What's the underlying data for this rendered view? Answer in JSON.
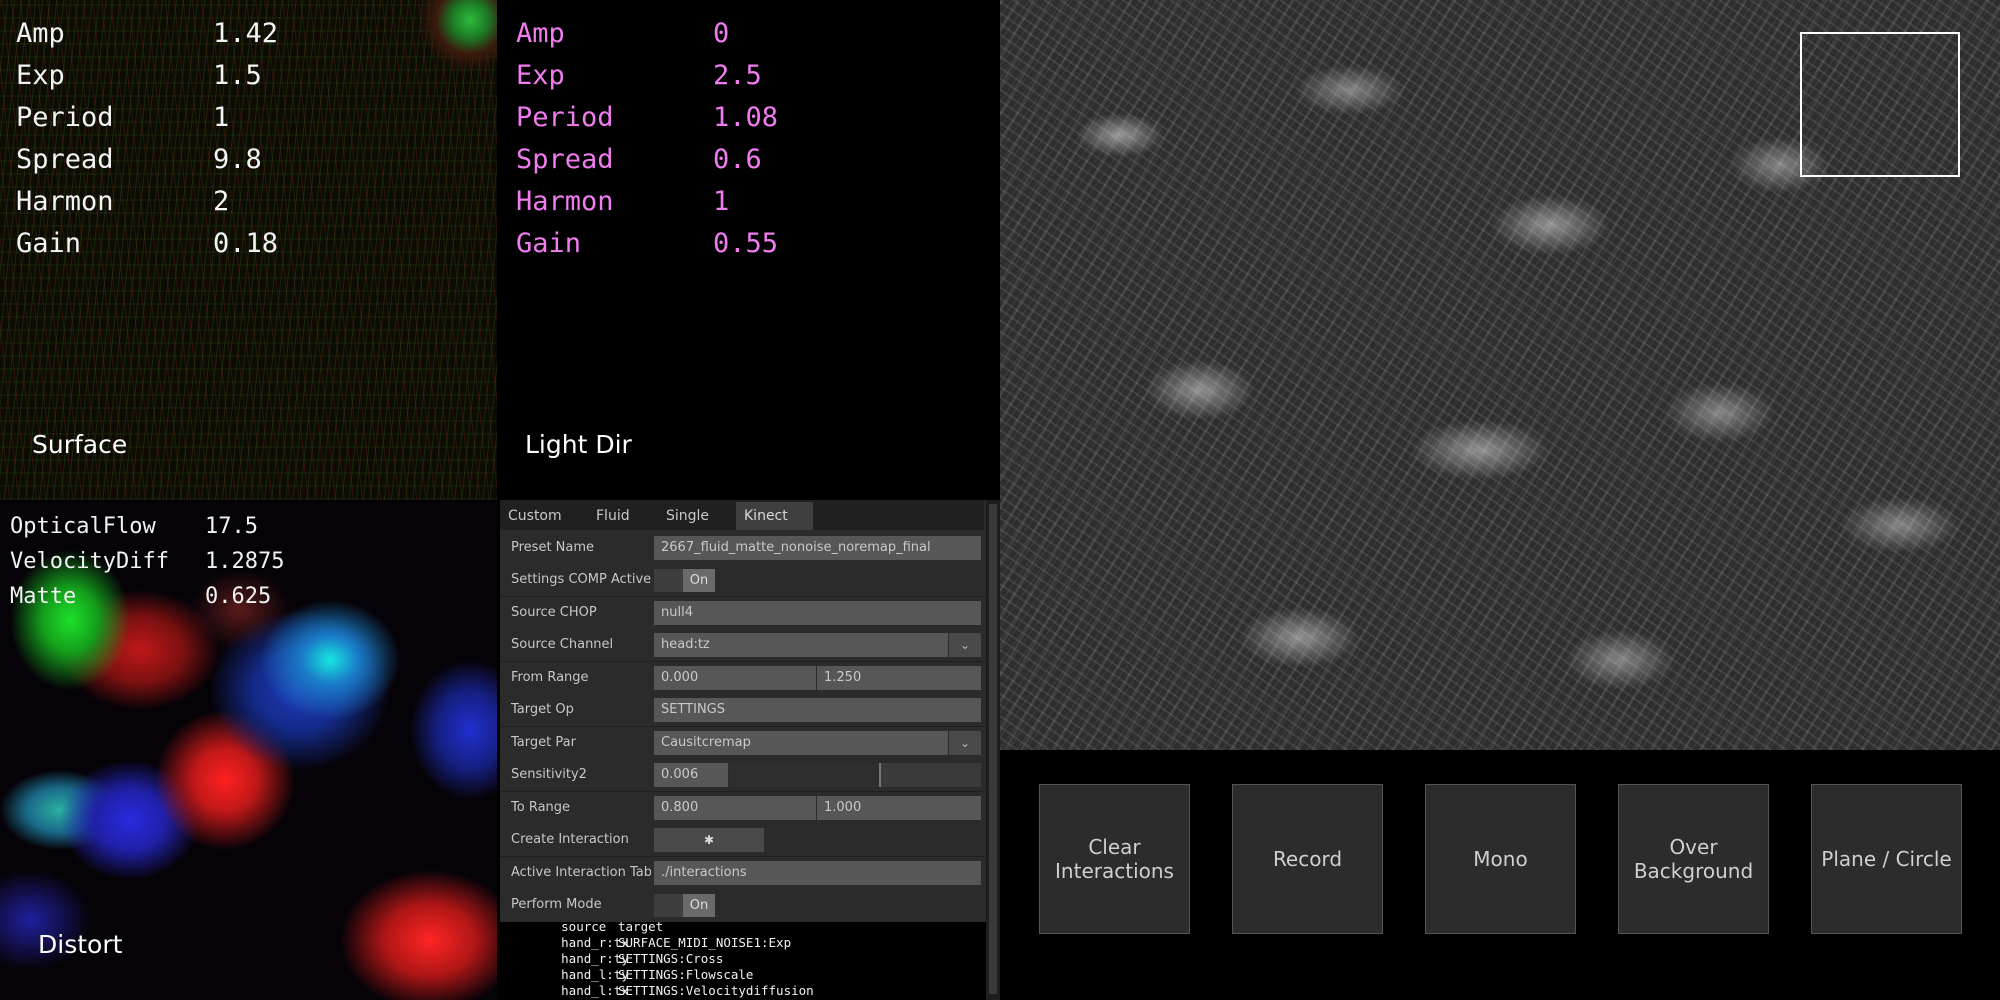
{
  "surface": {
    "label": "Surface",
    "params": [
      {
        "name": "Amp",
        "value": "1.42"
      },
      {
        "name": "Exp",
        "value": "1.5"
      },
      {
        "name": "Period",
        "value": "1"
      },
      {
        "name": "Spread",
        "value": "9.8"
      },
      {
        "name": "Harmon",
        "value": "2"
      },
      {
        "name": "Gain",
        "value": "0.18"
      }
    ]
  },
  "light_dir": {
    "label": "Light Dir",
    "params": [
      {
        "name": "Amp",
        "value": "0"
      },
      {
        "name": "Exp",
        "value": "2.5"
      },
      {
        "name": "Period",
        "value": "1.08"
      },
      {
        "name": "Spread",
        "value": "0.6"
      },
      {
        "name": "Harmon",
        "value": "1"
      },
      {
        "name": "Gain",
        "value": "0.55"
      }
    ]
  },
  "distort": {
    "label": "Distort",
    "params": [
      {
        "name": "OpticalFlow",
        "value": "17.5"
      },
      {
        "name": "VelocityDiff",
        "value": "1.2875"
      },
      {
        "name": "Matte",
        "value": "0.625"
      }
    ]
  },
  "panel": {
    "tabs": [
      {
        "label": "Custom"
      },
      {
        "label": "Fluid"
      },
      {
        "label": "Single"
      },
      {
        "label": "Kinect"
      }
    ],
    "active_tab": "Kinect",
    "preset_name": {
      "label": "Preset Name",
      "value": "2667_fluid_matte_nonoise_noremap_final"
    },
    "settings_comp_active": {
      "label": "Settings COMP Active in Pe",
      "value": "On"
    },
    "source_chop": {
      "label": "Source CHOP",
      "value": "null4"
    },
    "source_channel": {
      "label": "Source Channel",
      "value": "head:tz"
    },
    "from_range": {
      "label": "From Range",
      "min": "0.000",
      "max": "1.250"
    },
    "target_op": {
      "label": "Target Op",
      "value": "SETTINGS"
    },
    "target_par": {
      "label": "Target Par",
      "value": "Causitcremap"
    },
    "sensitivity2": {
      "label": "Sensitivity2",
      "value": "0.006",
      "level": 0.006
    },
    "to_range": {
      "label": "To Range",
      "min": "0.800",
      "max": "1.000"
    },
    "create_interaction": {
      "label": "Create Interaction",
      "icon": "running-figure-icon"
    },
    "active_interaction_table": {
      "label": "Active Interaction Table",
      "value": "./interactions"
    },
    "perform_mode": {
      "label": "Perform Mode",
      "value": "On"
    }
  },
  "interactions_table": {
    "columns": [
      "source",
      "target"
    ],
    "rows": [
      [
        "hand_r:tx",
        "SURFACE_MIDI_NOISE1:Exp"
      ],
      [
        "hand_r:ty",
        "SETTINGS:Cross"
      ],
      [
        "hand_l:ty",
        "SETTINGS:Flowscale"
      ],
      [
        "hand_l:tx",
        "SETTINGS:Velocitydiffusion"
      ]
    ]
  },
  "buttons": [
    {
      "label": "Clear\nInteractions"
    },
    {
      "label": "Record"
    },
    {
      "label": "Mono"
    },
    {
      "label": "Over\nBackground"
    },
    {
      "label": "Plane / Circle"
    }
  ],
  "colors": {
    "surface_text": "#f4f4f4",
    "light_dir_text": "#f07cf0",
    "panel_bg": "#2b2b2b",
    "field_bg": "#575757"
  }
}
